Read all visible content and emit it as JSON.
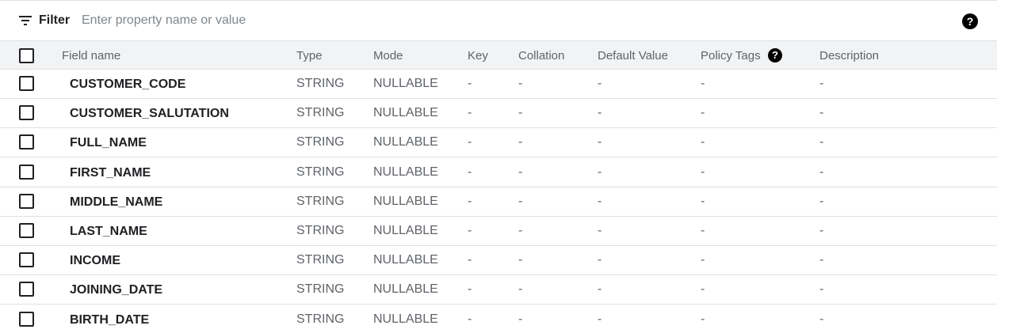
{
  "filter": {
    "label": "Filter",
    "placeholder": "Enter property name or value",
    "value": "",
    "help_glyph": "?"
  },
  "columns": [
    "Field name",
    "Type",
    "Mode",
    "Key",
    "Collation",
    "Default Value",
    "Policy Tags",
    "Description"
  ],
  "policy_help_glyph": "?",
  "rows": [
    [
      "CUSTOMER_CODE",
      "STRING",
      "NULLABLE",
      "-",
      "-",
      "-",
      "-",
      "-"
    ],
    [
      "CUSTOMER_SALUTATION",
      "STRING",
      "NULLABLE",
      "-",
      "-",
      "-",
      "-",
      "-"
    ],
    [
      "FULL_NAME",
      "STRING",
      "NULLABLE",
      "-",
      "-",
      "-",
      "-",
      "-"
    ],
    [
      "FIRST_NAME",
      "STRING",
      "NULLABLE",
      "-",
      "-",
      "-",
      "-",
      "-"
    ],
    [
      "MIDDLE_NAME",
      "STRING",
      "NULLABLE",
      "-",
      "-",
      "-",
      "-",
      "-"
    ],
    [
      "LAST_NAME",
      "STRING",
      "NULLABLE",
      "-",
      "-",
      "-",
      "-",
      "-"
    ],
    [
      "INCOME",
      "STRING",
      "NULLABLE",
      "-",
      "-",
      "-",
      "-",
      "-"
    ],
    [
      "JOINING_DATE",
      "STRING",
      "NULLABLE",
      "-",
      "-",
      "-",
      "-",
      "-"
    ],
    [
      "BIRTH_DATE",
      "STRING",
      "NULLABLE",
      "-",
      "-",
      "-",
      "-",
      "-"
    ]
  ],
  "icons": {
    "filter": "filter-list-icon",
    "help": "help-circle-icon",
    "checkbox": "checkbox-unchecked-icon"
  }
}
